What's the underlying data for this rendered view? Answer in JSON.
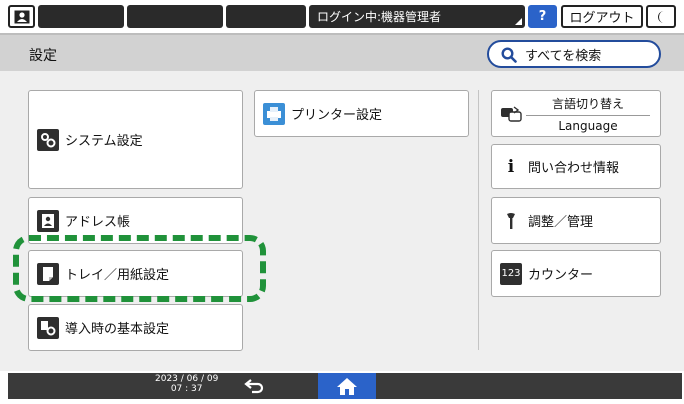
{
  "status": {
    "login_status": "ログイン中:機器管理者",
    "help_label": "?",
    "logout_label": "ログアウト"
  },
  "header": {
    "title": "設定",
    "search_all_label": "すべてを検索"
  },
  "tiles": {
    "printer_settings": "プリンター設定",
    "system_settings": "システム設定",
    "address_book": "アドレス帳",
    "tray_paper_settings": "トレイ／用紙設定",
    "initial_setup": "導入時の基本設定",
    "language_switch": "言語切り替え",
    "language_en": "Language",
    "inquiry_info": "問い合わせ情報",
    "maintenance": "調整／管理",
    "counter": "カウンター",
    "counter_icon_text": "123",
    "info_icon_text": "i"
  },
  "bottom": {
    "date": "2023 / 06 / 09",
    "time": "07 : 37"
  },
  "colors": {
    "highlight": "#20923a",
    "accent_blue": "#2b63c9"
  }
}
